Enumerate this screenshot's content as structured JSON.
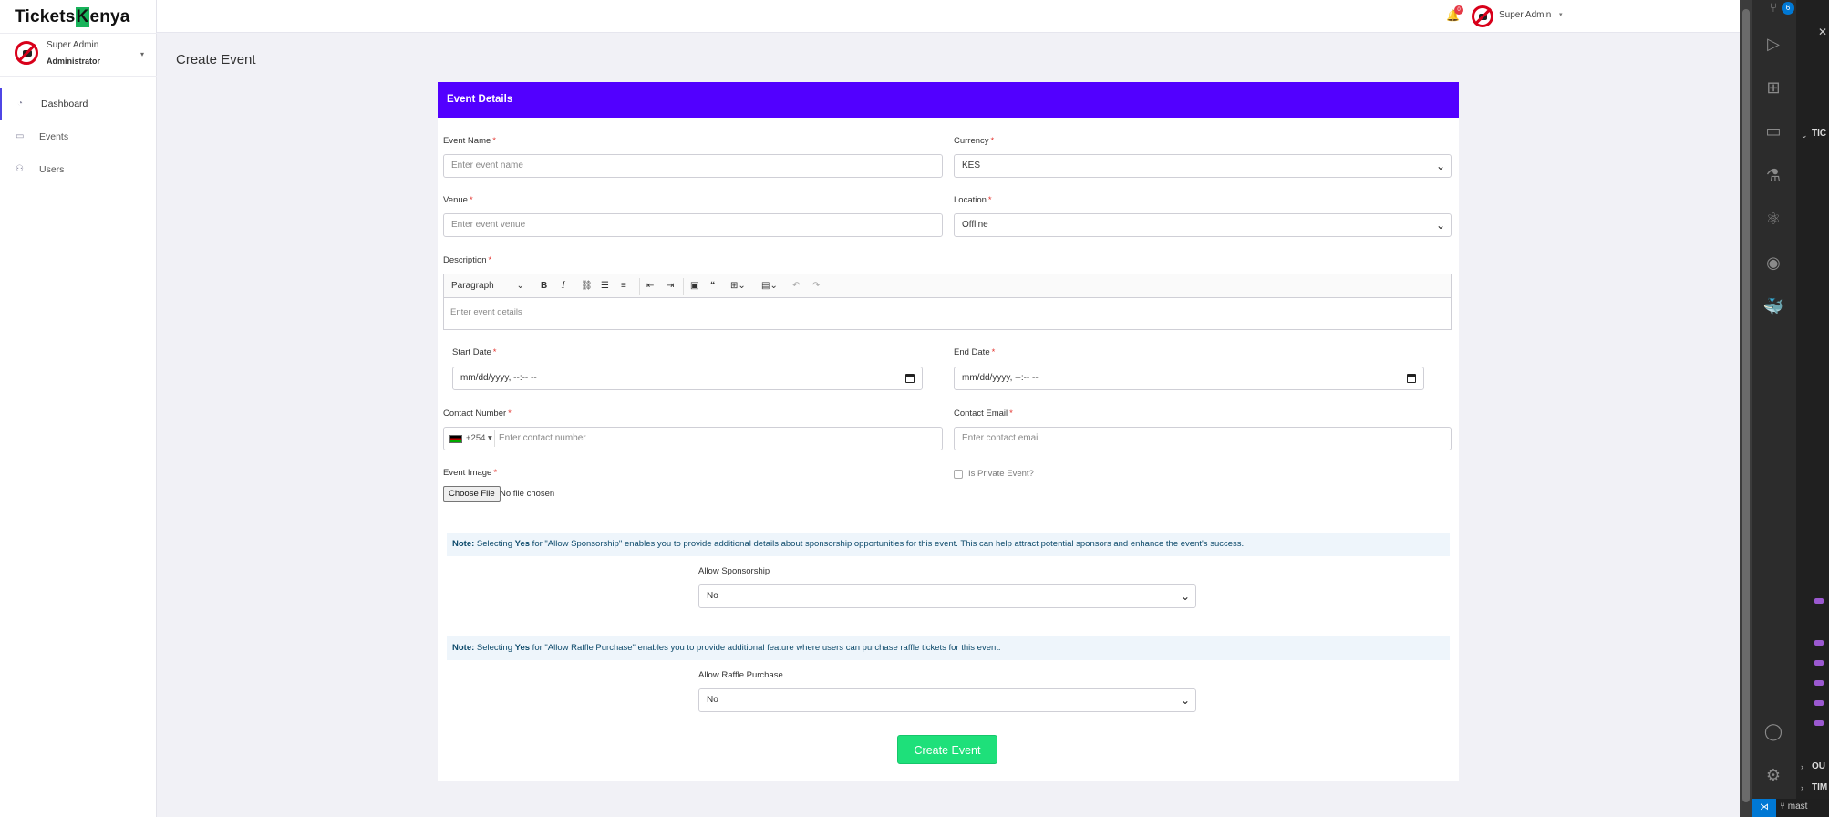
{
  "app": {
    "logo_part1": "Tickets",
    "logo_k": "K",
    "logo_part2": "enya"
  },
  "sidebar": {
    "user_name": "Super Admin",
    "user_role": "Administrator",
    "items": [
      {
        "label": "Dashboard",
        "icon": "dashboard-icon"
      },
      {
        "label": "Events",
        "icon": "monitor-icon"
      },
      {
        "label": "Users",
        "icon": "users-icon"
      }
    ]
  },
  "topbar": {
    "notification_count": "0",
    "user_name": "Super Admin"
  },
  "page": {
    "title": "Create Event",
    "card_title": "Event Details"
  },
  "form": {
    "event_name": {
      "label": "Event Name",
      "placeholder": "Enter event name"
    },
    "currency": {
      "label": "Currency",
      "value": "KES"
    },
    "venue": {
      "label": "Venue",
      "placeholder": "Enter event venue"
    },
    "location": {
      "label": "Location",
      "value": "Offline"
    },
    "description": {
      "label": "Description",
      "placeholder": "Enter event details",
      "paragraph_select": "Paragraph"
    },
    "start_date": {
      "label": "Start Date",
      "placeholder": "mm/dd/yyyy, --:-- --"
    },
    "end_date": {
      "label": "End Date",
      "placeholder": "mm/dd/yyyy, --:-- --"
    },
    "contact_number": {
      "label": "Contact Number",
      "code": "+254",
      "placeholder": "Enter contact number"
    },
    "contact_email": {
      "label": "Contact Email",
      "placeholder": "Enter contact email"
    },
    "event_image": {
      "label": "Event Image",
      "button": "Choose File",
      "status": "No file chosen"
    },
    "private_event": {
      "label": "Is Private Event?"
    },
    "required_mark": "*"
  },
  "sponsorship": {
    "note_prefix": "Note:",
    "note_mid1": " Selecting ",
    "note_yes": "Yes",
    "note_rest": " for \"Allow Sponsorship\" enables you to provide additional details about sponsorship opportunities for this event. This can help attract potential sponsors and enhance the event's success.",
    "label": "Allow Sponsorship",
    "value": "No"
  },
  "raffle": {
    "note_prefix": "Note:",
    "note_mid1": " Selecting ",
    "note_yes": "Yes",
    "note_rest": " for \"Allow Raffle Purchase\" enables you to provide additional feature where users can purchase raffle tickets for this event.",
    "label": "Allow Raffle Purchase",
    "value": "No"
  },
  "submit_label": "Create Event",
  "ide": {
    "badge": "6",
    "labels": [
      "TIC",
      "OU",
      "TIM"
    ],
    "branch": "mast"
  }
}
